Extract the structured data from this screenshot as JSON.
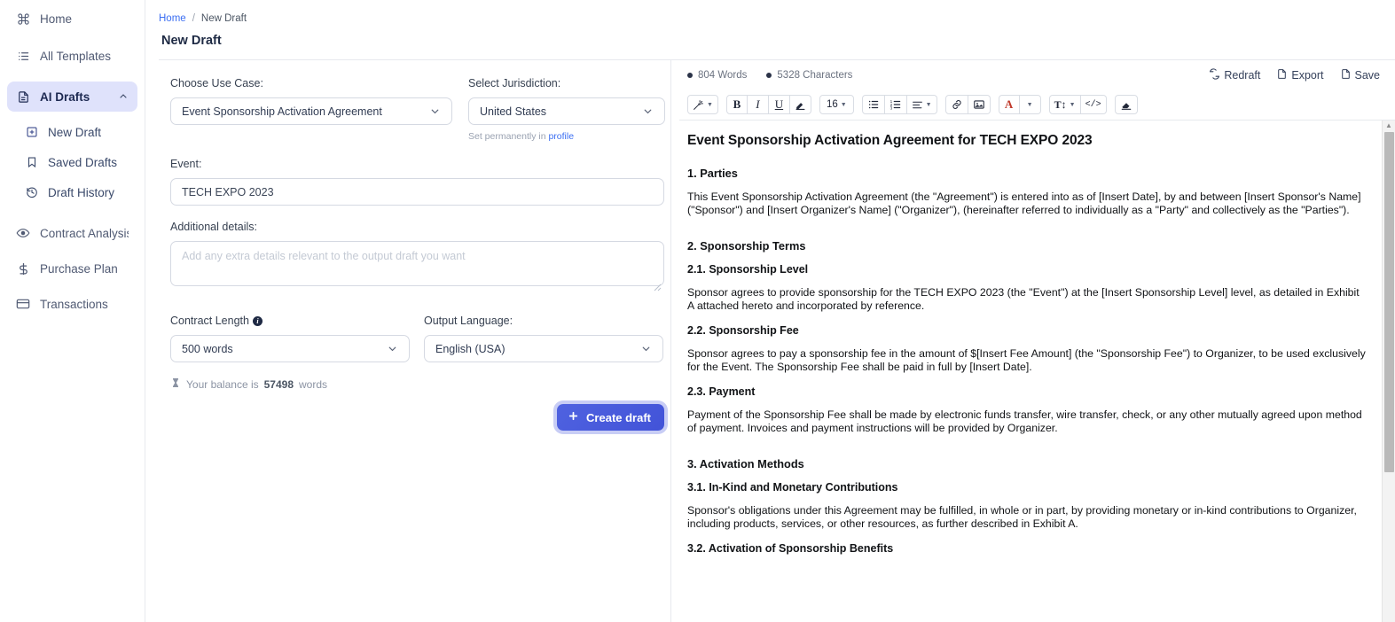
{
  "sidebar": {
    "items": [
      {
        "label": "Home",
        "icon": "command-icon",
        "active": false,
        "sub": false
      },
      {
        "label": "All Templates",
        "icon": "list-icon",
        "active": false,
        "sub": false
      },
      {
        "label": "AI Drafts",
        "icon": "document-icon",
        "active": true,
        "sub": false,
        "chevron": "chevron-up-icon"
      },
      {
        "label": "New Draft",
        "icon": "plus-square-icon",
        "active": false,
        "sub": true
      },
      {
        "label": "Saved Drafts",
        "icon": "bookmark-icon",
        "active": false,
        "sub": true
      },
      {
        "label": "Draft History",
        "icon": "history-icon",
        "active": false,
        "sub": true
      },
      {
        "label": "Contract Analysis",
        "icon": "eye-icon",
        "active": false,
        "sub": false
      },
      {
        "label": "Purchase Plan",
        "icon": "dollar-icon",
        "active": false,
        "sub": false
      },
      {
        "label": "Transactions",
        "icon": "card-icon",
        "active": false,
        "sub": false
      }
    ]
  },
  "breadcrumb": {
    "home": "Home",
    "separator": "/",
    "current": "New Draft"
  },
  "page": {
    "title": "New Draft"
  },
  "form": {
    "use_case": {
      "label": "Choose Use Case:",
      "value": "Event Sponsorship Activation Agreement"
    },
    "jurisdiction": {
      "label": "Select Jurisdiction:",
      "value": "United States",
      "helper_prefix": "Set permanently in ",
      "helper_link": "profile"
    },
    "event": {
      "label": "Event:",
      "value": "TECH EXPO 2023"
    },
    "additional_details": {
      "label": "Additional details:",
      "value": "",
      "placeholder": "Add any extra details relevant to the output draft you want"
    },
    "contract_length": {
      "label": "Contract Length",
      "value": "500 words"
    },
    "output_language": {
      "label": "Output Language:",
      "value": "English (USA)"
    },
    "balance": {
      "prefix": "Your balance is",
      "amount": "57498",
      "suffix": "words"
    },
    "create_button": {
      "label": "Create draft",
      "icon": "plus-icon"
    }
  },
  "editor": {
    "counters": [
      {
        "label": "804 Words"
      },
      {
        "label": "5328 Characters"
      }
    ],
    "actions": [
      {
        "label": "Redraft",
        "icon": "refresh-icon"
      },
      {
        "label": "Export",
        "icon": "file-export-icon"
      },
      {
        "label": "Save",
        "icon": "file-save-icon"
      }
    ],
    "toolbar": {
      "magic": {
        "name": "magic-wand-icon"
      },
      "bold": "B",
      "italic": "I",
      "underline": "U",
      "highlight": {
        "name": "highlighter-icon"
      },
      "font_size": "16",
      "bullet_list": {
        "name": "bullet-list-icon"
      },
      "numbered_list": {
        "name": "numbered-list-icon"
      },
      "align": {
        "name": "align-icon"
      },
      "link": {
        "name": "link-icon"
      },
      "image": {
        "name": "image-icon"
      },
      "text_color": "A",
      "line_height": "T↕",
      "code": "</>",
      "clear_format": {
        "name": "eraser-icon"
      }
    },
    "scroll": {
      "arrow": "▲"
    }
  },
  "document": {
    "title": "Event Sponsorship Activation Agreement for TECH EXPO 2023",
    "blocks": [
      {
        "type": "h2",
        "text": "1. Parties"
      },
      {
        "type": "p",
        "text": "This Event Sponsorship Activation Agreement (the \"Agreement\") is entered into as of [Insert Date], by and between [Insert Sponsor's Name] (\"Sponsor\") and [Insert Organizer's Name] (\"Organizer\"), (hereinafter referred to individually as a \"Party\" and collectively as the \"Parties\")."
      },
      {
        "type": "h2",
        "text": "2. Sponsorship Terms"
      },
      {
        "type": "h3",
        "text": "2.1. Sponsorship Level"
      },
      {
        "type": "p",
        "text": "Sponsor agrees to provide sponsorship for the TECH EXPO 2023 (the \"Event\") at the [Insert Sponsorship Level] level, as detailed in Exhibit A attached hereto and incorporated by reference."
      },
      {
        "type": "h3",
        "text": "2.2. Sponsorship Fee"
      },
      {
        "type": "p",
        "text": "Sponsor agrees to pay a sponsorship fee in the amount of $[Insert Fee Amount] (the \"Sponsorship Fee\") to Organizer, to be used exclusively for the Event. The Sponsorship Fee shall be paid in full by [Insert Date]."
      },
      {
        "type": "h3",
        "text": "2.3. Payment"
      },
      {
        "type": "p",
        "text": "Payment of the Sponsorship Fee shall be made by electronic funds transfer, wire transfer, check, or any other mutually agreed upon method of payment. Invoices and payment instructions will be provided by Organizer."
      },
      {
        "type": "h2",
        "text": "3. Activation Methods"
      },
      {
        "type": "h3",
        "text": "3.1. In-Kind and Monetary Contributions"
      },
      {
        "type": "p",
        "text": "Sponsor's obligations under this Agreement may be fulfilled, in whole or in part, by providing monetary or in-kind contributions to Organizer, including products, services, or other resources, as further described in Exhibit A."
      },
      {
        "type": "h3",
        "text": "3.2. Activation of Sponsorship Benefits"
      }
    ]
  },
  "colors": {
    "accent": "#4253d8",
    "link": "#3b6ef2",
    "sidebar_active_bg": "#dfe2fb",
    "text_color_red": "#c0392b"
  }
}
